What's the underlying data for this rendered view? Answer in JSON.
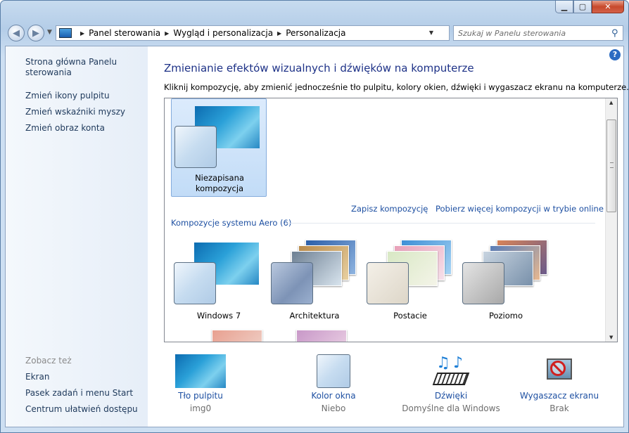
{
  "window": {
    "caption_min": "▁",
    "caption_max": "▢",
    "caption_close": "✕"
  },
  "nav": {
    "back_icon": "◀",
    "forward_icon": "▶",
    "breadcrumbs": [
      "Panel sterowania",
      "Wygląd i personalizacja",
      "Personalizacja"
    ],
    "search_placeholder": "Szukaj w Panelu sterowania"
  },
  "sidebar": {
    "links": [
      "Strona główna Panelu sterowania",
      "Zmień ikony pulpitu",
      "Zmień wskaźniki myszy",
      "Zmień obraz konta"
    ],
    "see_also_heading": "Zobacz też",
    "see_also": [
      "Ekran",
      "Pasek zadań i menu Start",
      "Centrum ułatwień dostępu"
    ]
  },
  "main": {
    "heading": "Zmienianie efektów wizualnych i dźwięków na komputerze",
    "description": "Kliknij kompozycję, aby zmienić jednocześnie tło pulpitu, kolory okien, dźwięki i wygaszacz ekranu na komputerze.",
    "unsaved_theme": "Niezapisana kompozycja",
    "save_theme": "Zapisz kompozycję",
    "get_more": "Pobierz więcej kompozycji w trybie online",
    "aero_heading": "Kompozycje systemu Aero (6)",
    "themes": [
      "Windows 7",
      "Architektura",
      "Postacie",
      "Poziomo"
    ]
  },
  "bottom": [
    {
      "label": "Tło pulpitu",
      "value": "img0"
    },
    {
      "label": "Kolor okna",
      "value": "Niebo"
    },
    {
      "label": "Dźwięki",
      "value": "Domyślne dla Windows"
    },
    {
      "label": "Wygaszacz ekranu",
      "value": "Brak"
    }
  ]
}
